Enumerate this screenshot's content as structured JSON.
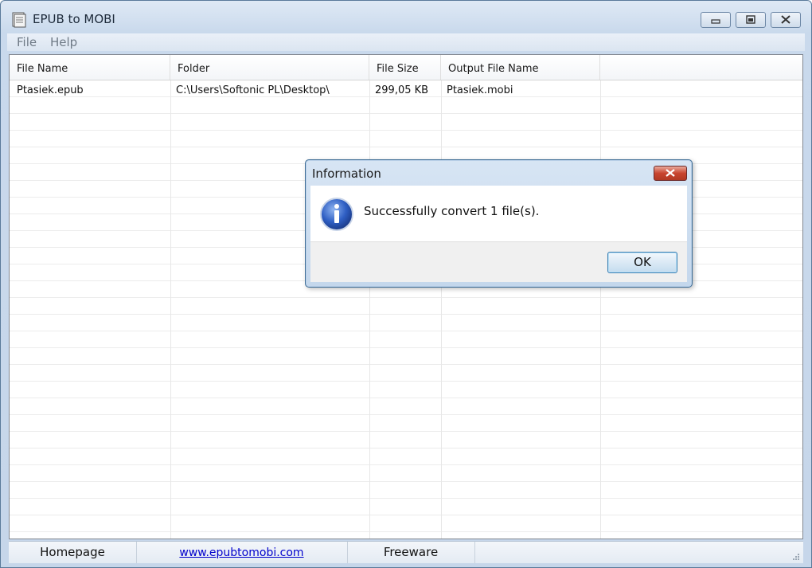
{
  "window": {
    "title": "EPUB to MOBI"
  },
  "menu": {
    "items": [
      "File",
      "Help"
    ]
  },
  "list": {
    "columns": [
      "File Name",
      "Folder",
      "File Size",
      "Output File Name"
    ],
    "rows": [
      {
        "file_name": "Ptasiek.epub",
        "folder": "C:\\Users\\Softonic PL\\Desktop\\",
        "file_size": "299,05 KB",
        "output_file_name": "Ptasiek.mobi"
      }
    ]
  },
  "status": {
    "homepage": "Homepage",
    "link": "www.epubtomobi.com",
    "license": "Freeware"
  },
  "dialog": {
    "title": "Information",
    "message": "Successfully convert 1 file(s).",
    "ok_label": "OK",
    "icon": "info-icon"
  },
  "colors": {
    "title_gradient_top": "#dfe9f5",
    "dialog_close": "#c8452f",
    "link": "#0000cc",
    "ok_border": "#3c7fb1"
  }
}
